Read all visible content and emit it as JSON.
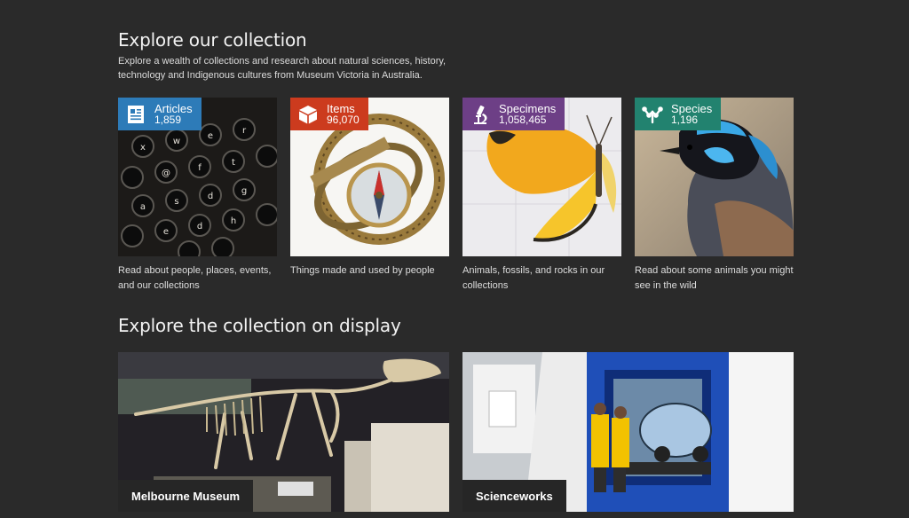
{
  "collection": {
    "title": "Explore our collection",
    "intro": "Explore a wealth of collections and research about natural sciences, history, technology and Indigenous cultures from Museum Victoria in Australia.",
    "cards": [
      {
        "name": "Articles",
        "count": "1,859",
        "desc": "Read about people, places, events, and our collections",
        "icon": "document-icon",
        "color": "#2d7bb8"
      },
      {
        "name": "Items",
        "count": "96,070",
        "desc": "Things made and used by people",
        "icon": "box-icon",
        "color": "#cc3b1e"
      },
      {
        "name": "Specimens",
        "count": "1,058,465",
        "desc": "Animals, fossils, and rocks in our collections",
        "icon": "microscope-icon",
        "color": "#6d3f86"
      },
      {
        "name": "Species",
        "count": "1,196",
        "desc": "Read about some animals you might see in the wild",
        "icon": "species-tree-icon",
        "color": "#22826f"
      }
    ]
  },
  "display": {
    "title": "Explore the collection on display",
    "venues": [
      {
        "label": "Melbourne Museum"
      },
      {
        "label": "Scienceworks"
      }
    ]
  }
}
